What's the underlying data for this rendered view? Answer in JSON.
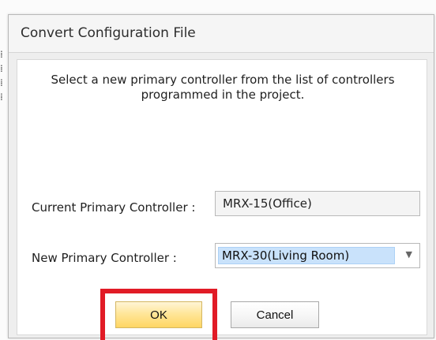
{
  "dialog": {
    "title": "Convert Configuration File",
    "instructions": "Select a new primary controller from the list of controllers programmed in the project.",
    "current_controller": {
      "label": "Current Primary Controller :",
      "value": "MRX-15(Office)"
    },
    "new_controller": {
      "label": "New Primary Controller :",
      "selected_value": "MRX-30(Living Room)",
      "dropdown_icon": "chevron-down-icon"
    },
    "buttons": {
      "ok_label": "OK",
      "cancel_label": "Cancel"
    },
    "highlight_color": "#e11b26",
    "ok_button_color": "#ffe69a"
  }
}
